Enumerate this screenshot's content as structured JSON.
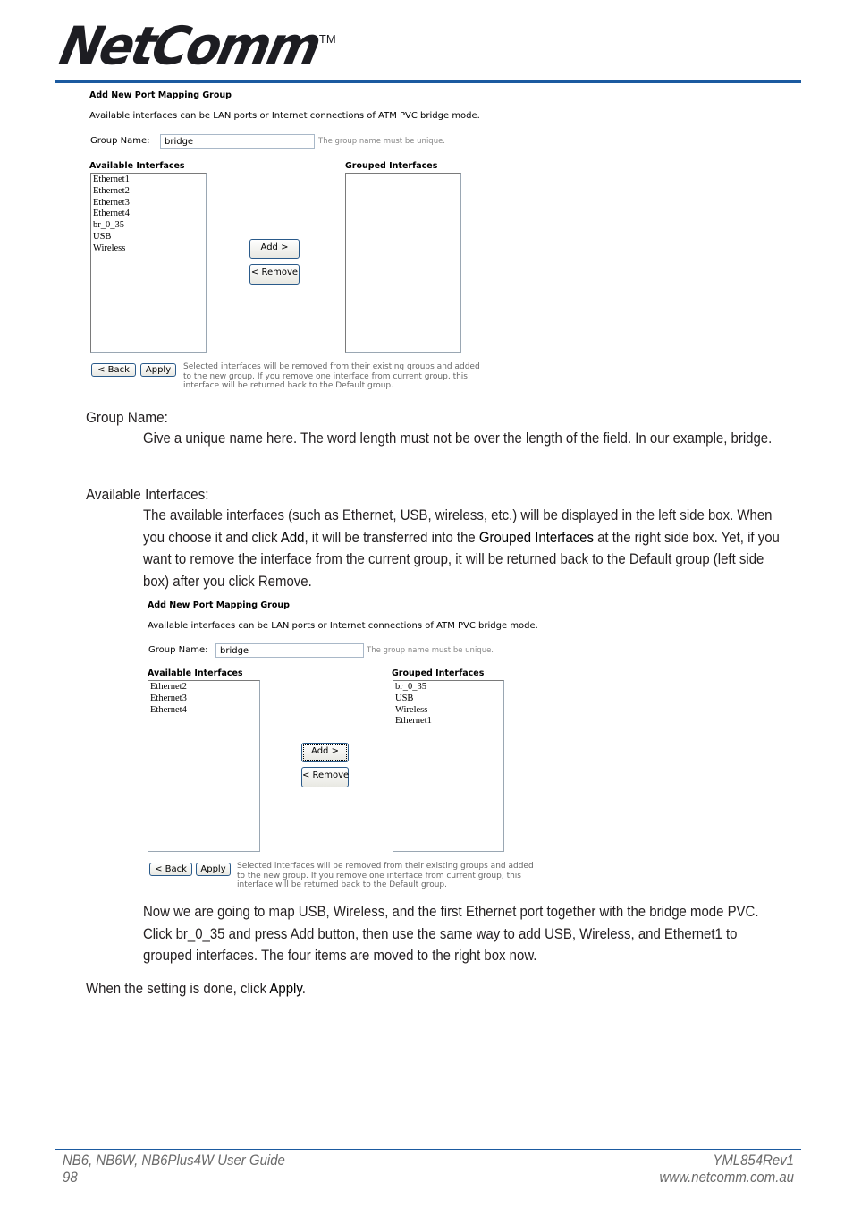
{
  "header": {
    "logo_text": "NetComm",
    "logo_tm": "TM",
    "brand_color": "#1b5aa0"
  },
  "panel1": {
    "title": "Add New Port Mapping Group",
    "description": "Available interfaces can be LAN ports or Internet connections of ATM PVC bridge mode.",
    "group_name_label": "Group Name:",
    "group_name_value": "bridge",
    "group_name_hint": "The group name must be unique.",
    "available_header": "Available Interfaces",
    "grouped_header": "Grouped Interfaces",
    "available_items": [
      "Ethernet1",
      "Ethernet2",
      "Ethernet3",
      "Ethernet4",
      "br_0_35",
      "USB",
      "Wireless"
    ],
    "grouped_items": [],
    "add_label": "Add >",
    "remove_label": "< Remove",
    "back_label": "< Back",
    "apply_label": "Apply",
    "note_lines": [
      "Selected interfaces will be removed from their existing groups and added",
      "to the new group. If you remove one interface from current group, this",
      "interface will be returned back to the Default group."
    ]
  },
  "sections": {
    "group_name": {
      "heading": "Group Name:",
      "text": "Give a unique name here. The word length must not be over the length of the field. In our example, bridge."
    },
    "available_interfaces": {
      "heading": "Available Interfaces:",
      "text_1": "The available interfaces (such as Ethernet, USB, wireless, etc.) will be displayed in the left side box. When you choose it and click ",
      "bold_1": "Add",
      "text_2": ", it will be transferred into the ",
      "bold_2": "Grouped Interfaces",
      "text_3": " at the right side box. Yet, if you want to remove the interface from the current group, it will be returned back to the Default group (left side box) after you click Remove."
    }
  },
  "panel2": {
    "title": "Add New Port Mapping Group",
    "description": "Available interfaces can be LAN ports or Internet connections of ATM PVC bridge mode.",
    "group_name_label": "Group Name:",
    "group_name_value": "bridge",
    "group_name_hint": "The group name must be unique.",
    "available_header": "Available Interfaces",
    "grouped_header": "Grouped Interfaces",
    "available_items": [
      "Ethernet2",
      "Ethernet3",
      "Ethernet4"
    ],
    "grouped_items": [
      "br_0_35",
      "USB",
      "Wireless",
      "Ethernet1"
    ],
    "add_label": "Add >",
    "remove_label": "< Remove",
    "back_label": "< Back",
    "apply_label": "Apply",
    "note_lines": [
      "Selected interfaces will be removed from their existing groups and added",
      "to the new group. If you remove one interface from current group, this",
      "interface will be returned back to the Default group."
    ]
  },
  "mapping_paragraph": "Now we are going to map USB, Wireless, and the first Ethernet port together with the bridge mode PVC. Click br_0_35 and press Add button, then use the same way to add USB, Wireless, and Ethernet1 to grouped interfaces. The four items are moved to the right box now.",
  "final": {
    "text": "When the setting is done, click ",
    "bold": "Apply",
    "end": "."
  },
  "footer": {
    "guide_title": "NB6, NB6W, NB6Plus4W User Guide",
    "page_number": "98",
    "doc_code": "YML854Rev1",
    "website": "www.netcomm.com.au"
  }
}
